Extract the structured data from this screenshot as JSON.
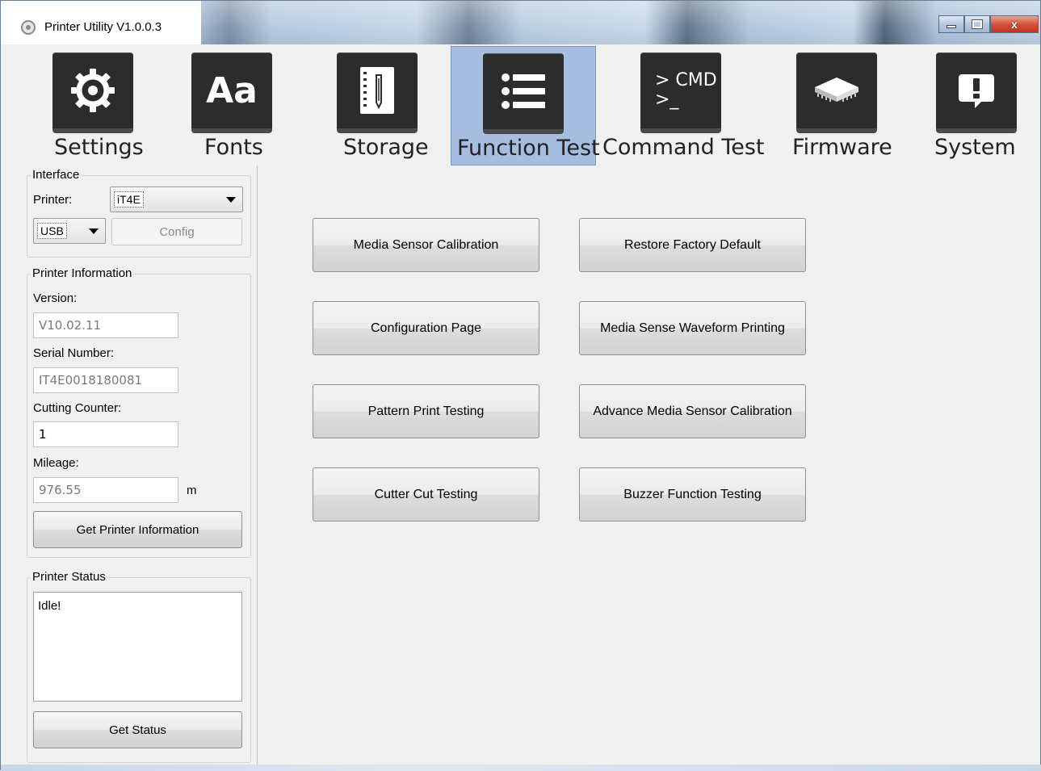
{
  "window": {
    "title": "Printer Utility  V1.0.0.3",
    "close_glyph": "x"
  },
  "toolbar": {
    "items": [
      {
        "label": "Settings",
        "icon": "gear-icon",
        "active": false
      },
      {
        "label": "Fonts",
        "icon": "fonts-icon",
        "icon_text": "Aa",
        "active": false
      },
      {
        "label": "Storage",
        "icon": "storage-icon",
        "active": false
      },
      {
        "label": "Function Test",
        "icon": "list-icon",
        "active": true
      },
      {
        "label": "Command Test",
        "icon": "cmd-icon",
        "icon_text": "> CMD",
        "icon_text2": ">_",
        "active": false
      },
      {
        "label": "Firmware",
        "icon": "chip-icon",
        "active": false
      },
      {
        "label": "System",
        "icon": "alert-icon",
        "icon_text": "!",
        "active": false
      }
    ],
    "active_color": "#a7bde0"
  },
  "interface": {
    "title": "Interface",
    "printer_label": "Printer:",
    "printer_value": "iT4E",
    "port_value": "USB",
    "config_label": "Config"
  },
  "printer_info": {
    "title": "Printer Information",
    "version_label": "Version:",
    "version_value": "V10.02.11",
    "serial_label": "Serial Number:",
    "serial_value": "IT4E0018180081",
    "cutting_label": "Cutting Counter:",
    "cutting_value": "1",
    "mileage_label": "Mileage:",
    "mileage_value": "976.55",
    "mileage_unit": "m",
    "get_info_label": "Get Printer Information"
  },
  "printer_status": {
    "title": "Printer Status",
    "status_text": "Idle!",
    "get_status_label": "Get Status"
  },
  "function_test": {
    "buttons": [
      {
        "label": "Media Sensor Calibration"
      },
      {
        "label": "Restore Factory Default"
      },
      {
        "label": "Configuration Page"
      },
      {
        "label": "Media Sense Waveform Printing"
      },
      {
        "label": "Pattern Print Testing"
      },
      {
        "label": "Advance Media Sensor Calibration"
      },
      {
        "label": "Cutter Cut Testing"
      },
      {
        "label": "Buzzer Function Testing"
      }
    ]
  }
}
